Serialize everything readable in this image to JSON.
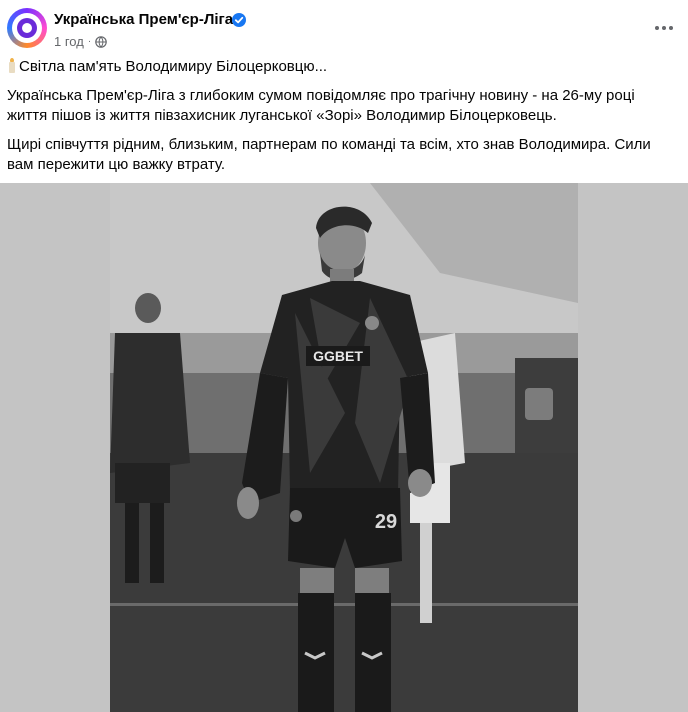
{
  "post": {
    "page_name": "Українська Прем'єр-Ліга",
    "time": "1 год",
    "separator": "·",
    "headline": "Світла пам'ять Володимиру Білоцерковцю...",
    "paragraph1": "Українська Прем'єр-Ліга з глибоким сумом повідомляє про трагічну новину - на 26-му році життя пішов із життя півзахисник луганської «Зорі» Володимир Білоцерковець.",
    "paragraph2": "Щирі співчуття рідним, близьким, партнерам по команді та всім, хто знав Володимира. Сили вам пережити цю важку втрату."
  },
  "icons": {
    "avatar": "upl-logo",
    "verified": "verified-badge-icon",
    "audience": "globe-icon",
    "more": "more-options-icon",
    "emoji": "candle-icon"
  },
  "photo": {
    "sponsor_text": "GGBET",
    "shirt_number": "29"
  },
  "colors": {
    "accent": "#1877f2",
    "secondary_text": "#65676b",
    "primary_text": "#050505"
  }
}
